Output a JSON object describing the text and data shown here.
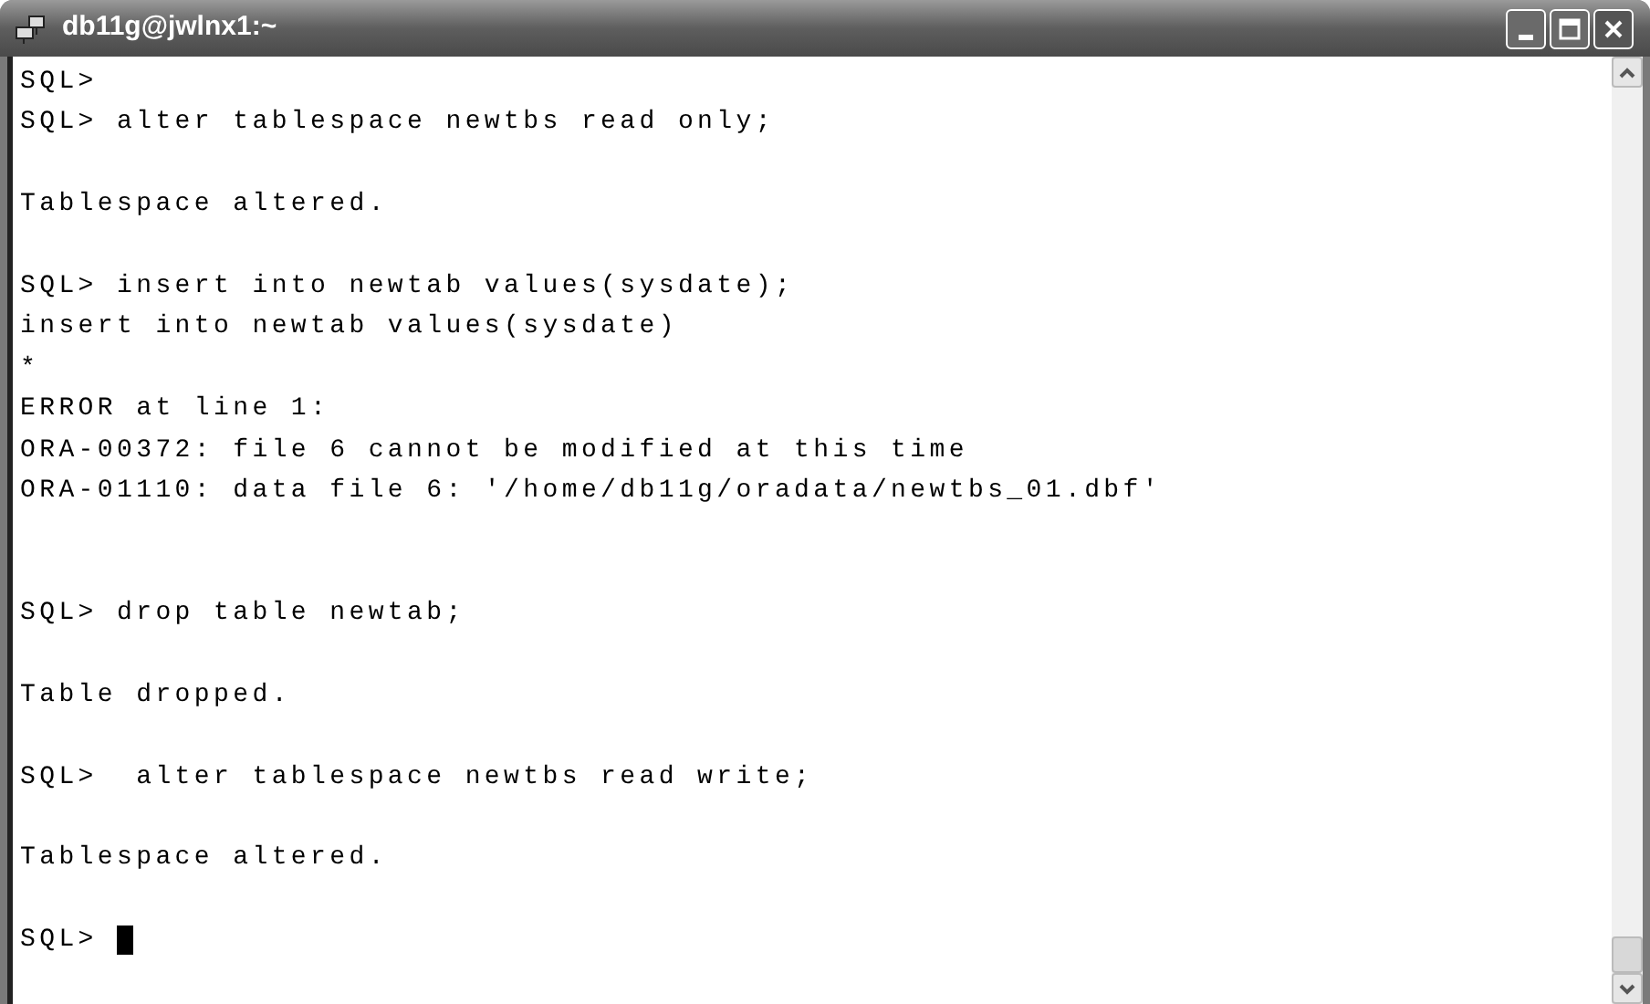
{
  "window": {
    "title": "db11g@jwlnx1:~"
  },
  "terminal": {
    "cursor_visible": true,
    "lines": [
      {
        "kind": "text",
        "text": "SQL>"
      },
      {
        "kind": "text",
        "text": "SQL> alter tablespace newtbs read only;"
      },
      {
        "kind": "blank"
      },
      {
        "kind": "text",
        "text": "Tablespace altered."
      },
      {
        "kind": "blank"
      },
      {
        "kind": "text",
        "text": "SQL> insert into newtab values(sysdate);"
      },
      {
        "kind": "text",
        "text": "insert into newtab values(sysdate)"
      },
      {
        "kind": "text",
        "text": "*"
      },
      {
        "kind": "text",
        "text": "ERROR at line 1:"
      },
      {
        "kind": "text",
        "text": "ORA-00372: file 6 cannot be modified at this time"
      },
      {
        "kind": "text",
        "text": "ORA-01110: data file 6: '/home/db11g/oradata/newtbs_01.dbf'"
      },
      {
        "kind": "blank"
      },
      {
        "kind": "blank"
      },
      {
        "kind": "text",
        "text": "SQL> drop table newtab;"
      },
      {
        "kind": "blank"
      },
      {
        "kind": "text",
        "text": "Table dropped."
      },
      {
        "kind": "blank"
      },
      {
        "kind": "text",
        "text": "SQL>  alter tablespace newtbs read write;"
      },
      {
        "kind": "blank"
      },
      {
        "kind": "text",
        "text": "Tablespace altered."
      },
      {
        "kind": "blank"
      },
      {
        "kind": "text",
        "text": "SQL> "
      }
    ]
  }
}
